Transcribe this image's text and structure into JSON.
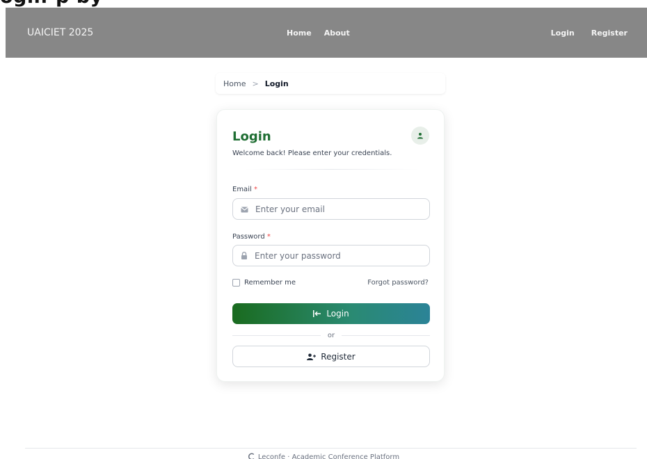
{
  "top_fragment": "ogin-p by",
  "nav": {
    "brand": "UAICIET 2025",
    "center": [
      {
        "label": "Home"
      },
      {
        "label": "About"
      }
    ],
    "right": [
      {
        "label": "Login"
      },
      {
        "label": "Register"
      }
    ]
  },
  "breadcrumb": {
    "home": "Home",
    "separator": ">",
    "current": "Login"
  },
  "card": {
    "title": "Login",
    "subtitle": "Welcome back! Please enter your credentials.",
    "avatar_icon": "user-icon",
    "email": {
      "label": "Email",
      "required": "*",
      "placeholder": "Enter your email",
      "icon": "envelope-icon"
    },
    "password": {
      "label": "Password",
      "required": "*",
      "placeholder": "Enter your password",
      "icon": "lock-icon"
    },
    "remember_label": "Remember me",
    "forgot_label": "Forgot password?",
    "login_button": {
      "label": "Login",
      "icon": "sign-in-icon"
    },
    "or_label": "or",
    "register_button": {
      "label": "Register",
      "icon": "user-plus-icon"
    }
  },
  "footer": {
    "text": "Leconfe · Academic Conference Platform",
    "icon": "leconfe-logo-icon"
  },
  "colors": {
    "nav_bg": "#878787",
    "title_green": "#1f6e33",
    "gradient_start": "#1a6b1f",
    "gradient_end": "#2b8397",
    "required": "#ef4444"
  }
}
